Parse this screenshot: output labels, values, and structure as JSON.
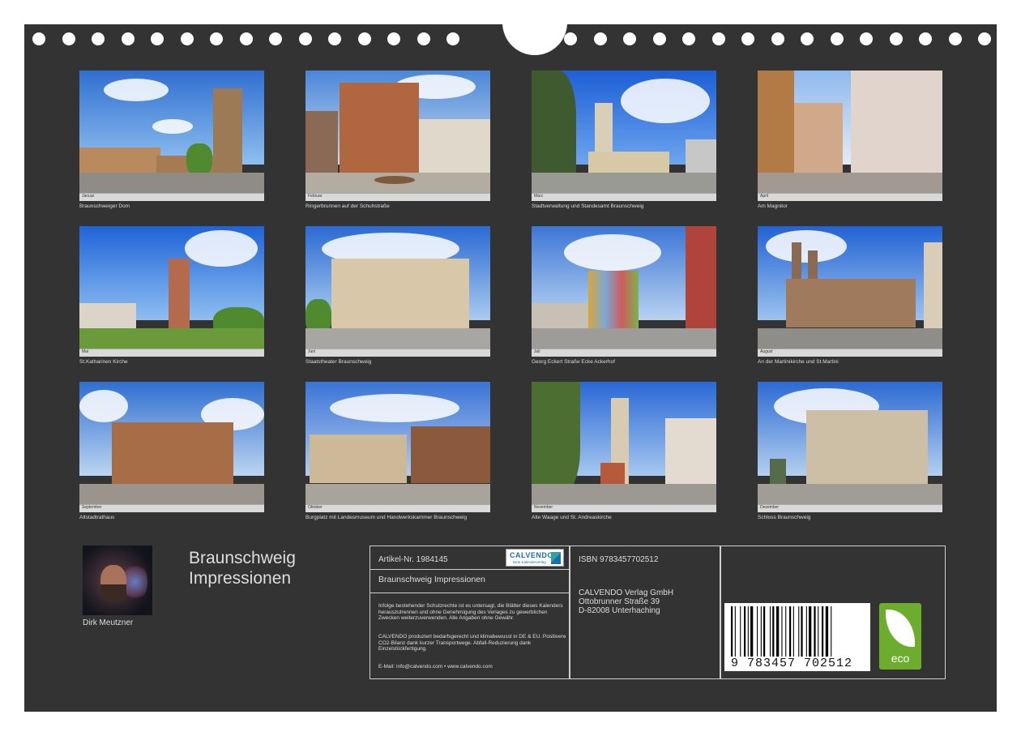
{
  "calendar": {
    "title_line1": "Braunschweig",
    "title_line2": "Impressionen",
    "author": "Dirk Meutzner"
  },
  "photos": [
    {
      "caption": "Braunschweiger Dom",
      "month": "Januar"
    },
    {
      "caption": "Ringerbrunnen auf der Schuhstraße",
      "month": "Februar"
    },
    {
      "caption": "Stadtverwaltung und Standesamt Braunschweig",
      "month": "März"
    },
    {
      "caption": "Am Magnitor",
      "month": "April"
    },
    {
      "caption": "St.Katharinen Kirche",
      "month": "Mai"
    },
    {
      "caption": "Staatstheater Braunschweig",
      "month": "Juni"
    },
    {
      "caption": "Georg Eckert Straße Ecke Ackerhof",
      "month": "Juli"
    },
    {
      "caption": "An der Martinikirche und St.Martini",
      "month": "August"
    },
    {
      "caption": "Altstadtrathaus",
      "month": "September"
    },
    {
      "caption": "Burgplatz mit Landesmuseum und Handwerkskammer Braunschweig",
      "month": "Oktober"
    },
    {
      "caption": "Alte Waage und St. Andreaskirche",
      "month": "November"
    },
    {
      "caption": "Schloss Braunschweig",
      "month": "Dezember"
    }
  ],
  "info": {
    "article": "Artikel-Nr. 1984145",
    "product_title": "Braunschweig Impressionen",
    "copyright_text": "Infolge bestehender Schutzrechte ist es untersagt, die Blätter dieses Kalenders herauszutrennen und ohne Genehmigung des Verlages zu gewerblichen Zwecken weiterzuverwenden. Alle Angaben ohne Gewähr.",
    "eco_text": "CALVENDO produziert bedarfsgerecht und klimabewusst in DE & EU. Positivere CO2-Bilanz dank kurzer Transportwege. Abfall-Reduzierung dank Einzelstückfertigung.",
    "email_line": "E-Mail: info@calvendo.com • www.calvendo.com",
    "isbn": "ISBN 9783457702512",
    "publisher_name": "CALVENDO Verlag GmbH",
    "publisher_street": "Ottobrunner Straße 39",
    "publisher_city": "D-82008 Unterhaching",
    "logo_brand": "CALVENDO",
    "logo_sub": "Dein Kalenderverlag",
    "barcode_digits": "9 783457 702512",
    "eco_label": "eco"
  },
  "colors": {
    "background": "#333333",
    "text": "#dddddd",
    "eco_green": "#6dad2e",
    "calvendo_blue": "#1a6fa8"
  }
}
